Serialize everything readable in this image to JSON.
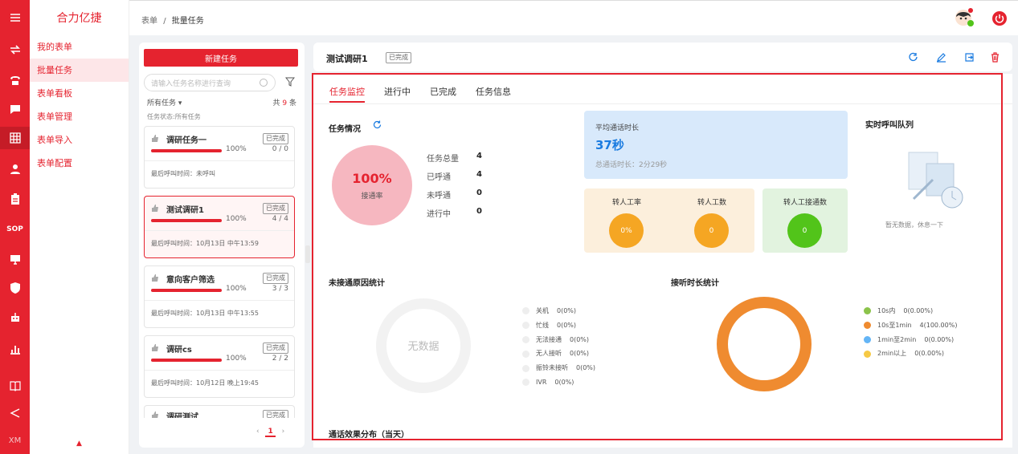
{
  "app": {
    "brand": "合力亿捷"
  },
  "rail": {
    "sop_label": "SOP",
    "xm_label": "XM"
  },
  "menu": {
    "items": [
      "我的表单",
      "批量任务",
      "表单看板",
      "表单管理",
      "表单导入",
      "表单配置"
    ]
  },
  "breadcrumb": {
    "parent": "表单",
    "sep": "/",
    "current": "批量任务"
  },
  "task_list": {
    "new_button": "新建任务",
    "search_placeholder": "请输入任务名称进行查询",
    "filter_label": "所有任务",
    "total_prefix": "共",
    "total_count": "9",
    "total_suffix": "条",
    "status_line": "任务状态:所有任务",
    "cards": [
      {
        "title": "调研任务一",
        "badge": "已完成",
        "percent": "100%",
        "progress": 1.0,
        "ratio": "0 / 0",
        "last": "最后呼叫时间：未呼叫"
      },
      {
        "title": "测试调研1",
        "badge": "已完成",
        "percent": "100%",
        "progress": 1.0,
        "ratio": "4 / 4",
        "last": "最后呼叫时间：10月13日 中午13:59"
      },
      {
        "title": "意向客户筛选",
        "badge": "已完成",
        "percent": "100%",
        "progress": 1.0,
        "ratio": "3 / 3",
        "last": "最后呼叫时间：10月13日 中午13:55"
      },
      {
        "title": "调研cs",
        "badge": "已完成",
        "percent": "100%",
        "progress": 1.0,
        "ratio": "2 / 2",
        "last": "最后呼叫时间：10月12日 晚上19:45"
      },
      {
        "title": "调研测试",
        "badge": "已完成"
      }
    ],
    "pager": {
      "prev": "‹",
      "current": "1",
      "next": "›"
    }
  },
  "detail": {
    "title": "测试调研1",
    "badge": "已完成",
    "tabs": [
      "任务监控",
      "进行中",
      "已完成",
      "任务信息"
    ],
    "task_status": {
      "title": "任务情况",
      "rate": "100%",
      "rate_label": "接通率",
      "stats": [
        {
          "label": "任务总量",
          "value": "4"
        },
        {
          "label": "已呼通",
          "value": "4"
        },
        {
          "label": "未呼通",
          "value": "0"
        },
        {
          "label": "进行中",
          "value": "0"
        }
      ]
    },
    "avg_call": {
      "title": "平均通话时长",
      "value": "37秒",
      "total": "总通话时长：2分29秒"
    },
    "transfer": [
      {
        "label": "转人工率",
        "value": "0%",
        "color": "#f5a623"
      },
      {
        "label": "转人工数",
        "value": "0",
        "color": "#f5a623"
      },
      {
        "label": "转人工接通数",
        "value": "0",
        "color": "#52c41a"
      }
    ],
    "queue": {
      "title": "实时呼叫队列",
      "empty": "暂无数据，休息一下"
    },
    "unanswered": {
      "title": "未接通原因统计",
      "empty": "无数据",
      "legend": [
        {
          "label": "关机",
          "value": "0(0%)"
        },
        {
          "label": "忙线",
          "value": "0(0%)"
        },
        {
          "label": "无法接通",
          "value": "0(0%)"
        },
        {
          "label": "无人接听",
          "value": "0(0%)"
        },
        {
          "label": "振铃未接听",
          "value": "0(0%)"
        },
        {
          "label": "IVR",
          "value": "0(0%)"
        }
      ]
    },
    "duration": {
      "title": "接听时长统计",
      "legend": [
        {
          "label": "10s内",
          "value": "0(0.00%)",
          "color": "#8bc34a"
        },
        {
          "label": "10s至1min",
          "value": "4(100.00%)",
          "color": "#ef8b30"
        },
        {
          "label": "1min至2min",
          "value": "0(0.00%)",
          "color": "#64b5f6"
        },
        {
          "label": "2min以上",
          "value": "0(0.00%)",
          "color": "#f6c945"
        }
      ]
    },
    "effect": {
      "title": "通话效果分布（当天）"
    }
  },
  "colors": {
    "accent": "#e5232f",
    "blue": "#1a7be0",
    "orange": "#ef8b30"
  }
}
